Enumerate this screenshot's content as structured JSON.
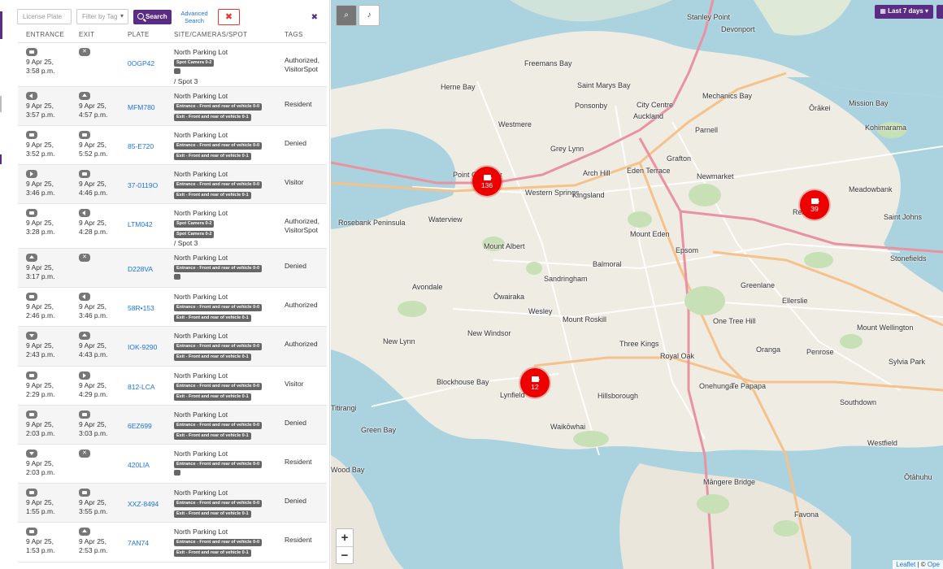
{
  "toolbar": {
    "license_placeholder": "License Plate",
    "tag_placeholder": "Filter by Tag",
    "search_label": "Search",
    "advanced_line1": "Advanced",
    "advanced_line2": "Search",
    "clear_label": "✖",
    "close_label": "✖"
  },
  "columns": [
    "ENTRANCE",
    "EXIT",
    "PLATE",
    "SITE/CAMERAS/SPOT",
    "TAGS"
  ],
  "rows": [
    {
      "entrance_icon": "cam",
      "entrance_date": "9 Apr 25,",
      "entrance_time": "3:58 p.m.",
      "exit_icon": "x",
      "exit_date": "",
      "exit_time": "",
      "plate": "0OGP42",
      "site": "North Parking Lot",
      "chips": [
        "Spot Camera 0-2",
        "_"
      ],
      "spot": "/ Spot 3",
      "tags": "Authorized, VisitorSpot"
    },
    {
      "entrance_icon": "left",
      "entrance_date": "9 Apr 25,",
      "entrance_time": "3:57 p.m.",
      "exit_icon": "up",
      "exit_date": "9 Apr 25,",
      "exit_time": "4:57 p.m.",
      "plate": "MFM780",
      "site": "North Parking Lot",
      "chips": [
        "Entrance - Front and rear of vehicle 0-0",
        "Exit - Front and rear of vehicle 0-1"
      ],
      "spot": "",
      "tags": "Resident"
    },
    {
      "entrance_icon": "cam",
      "entrance_date": "9 Apr 25,",
      "entrance_time": "3:52 p.m.",
      "exit_icon": "cam",
      "exit_date": "9 Apr 25,",
      "exit_time": "5:52 p.m.",
      "plate": "85-E720",
      "site": "North Parking Lot",
      "chips": [
        "Entrance - Front and rear of vehicle 0-0",
        "Exit - Front and rear of vehicle 0-1"
      ],
      "spot": "",
      "tags": "Denied"
    },
    {
      "entrance_icon": "right",
      "entrance_date": "9 Apr 25,",
      "entrance_time": "3:46 p.m.",
      "exit_icon": "cam",
      "exit_date": "9 Apr 25,",
      "exit_time": "4:46 p.m.",
      "plate": "37-0119O",
      "site": "North Parking Lot",
      "chips": [
        "Entrance - Front and rear of vehicle 0-0",
        "Exit - Front and rear of vehicle 0-1"
      ],
      "spot": "",
      "tags": "Visitor"
    },
    {
      "entrance_icon": "cam",
      "entrance_date": "9 Apr 25,",
      "entrance_time": "3:28 p.m.",
      "exit_icon": "left",
      "exit_date": "9 Apr 25,",
      "exit_time": "4:28 p.m.",
      "plate": "LTM042",
      "site": "North Parking Lot",
      "chips": [
        "Spot Camera 0-2",
        "Spot Camera 0-2"
      ],
      "spot": "/ Spot 3",
      "tags": "Authorized, VisitorSpot"
    },
    {
      "entrance_icon": "up",
      "entrance_date": "9 Apr 25,",
      "entrance_time": "3:17 p.m.",
      "exit_icon": "x",
      "exit_date": "",
      "exit_time": "",
      "plate": "D228VA",
      "site": "North Parking Lot",
      "chips": [
        "Entrance - Front and rear of vehicle 0-0",
        "_"
      ],
      "spot": "",
      "tags": "Denied"
    },
    {
      "entrance_icon": "cam",
      "entrance_date": "9 Apr 25,",
      "entrance_time": "2:46 p.m.",
      "exit_icon": "left",
      "exit_date": "9 Apr 25,",
      "exit_time": "3:46 p.m.",
      "plate": "58R•153",
      "site": "North Parking Lot",
      "chips": [
        "Entrance - Front and rear of vehicle 0-0",
        "Exit - Front and rear of vehicle 0-1"
      ],
      "spot": "",
      "tags": "Authorized"
    },
    {
      "entrance_icon": "down",
      "entrance_date": "9 Apr 25,",
      "entrance_time": "2:43 p.m.",
      "exit_icon": "up",
      "exit_date": "9 Apr 25,",
      "exit_time": "4:43 p.m.",
      "plate": "IOK-9290",
      "site": "North Parking Lot",
      "chips": [
        "Entrance - Front and rear of vehicle 0-0",
        "Exit - Front and rear of vehicle 0-1"
      ],
      "spot": "",
      "tags": "Authorized"
    },
    {
      "entrance_icon": "cam",
      "entrance_date": "9 Apr 25,",
      "entrance_time": "2:29 p.m.",
      "exit_icon": "right",
      "exit_date": "9 Apr 25,",
      "exit_time": "4:29 p.m.",
      "plate": "812-LCA",
      "site": "North Parking Lot",
      "chips": [
        "Entrance - Front and rear of vehicle 0-0",
        "Exit - Front and rear of vehicle 0-1"
      ],
      "spot": "",
      "tags": "Visitor"
    },
    {
      "entrance_icon": "cam",
      "entrance_date": "9 Apr 25,",
      "entrance_time": "2:03 p.m.",
      "exit_icon": "cam",
      "exit_date": "9 Apr 25,",
      "exit_time": "3:03 p.m.",
      "plate": "6EZ699",
      "site": "North Parking Lot",
      "chips": [
        "Entrance - Front and rear of vehicle 0-0",
        "Exit - Front and rear of vehicle 0-1"
      ],
      "spot": "",
      "tags": "Denied"
    },
    {
      "entrance_icon": "down",
      "entrance_date": "9 Apr 25,",
      "entrance_time": "2:03 p.m.",
      "exit_icon": "x",
      "exit_date": "",
      "exit_time": "",
      "plate": "420LIA",
      "site": "North Parking Lot",
      "chips": [
        "Entrance - Front and rear of vehicle 0-0",
        "_"
      ],
      "spot": "",
      "tags": "Resident"
    },
    {
      "entrance_icon": "cam",
      "entrance_date": "9 Apr 25,",
      "entrance_time": "1:55 p.m.",
      "exit_icon": "cam",
      "exit_date": "9 Apr 25,",
      "exit_time": "3:55 p.m.",
      "plate": "XXZ-8494",
      "site": "North Parking Lot",
      "chips": [
        "Entrance - Front and rear of vehicle 0-0",
        "Exit - Front and rear of vehicle 0-1"
      ],
      "spot": "",
      "tags": "Denied"
    },
    {
      "entrance_icon": "cam",
      "entrance_date": "9 Apr 25,",
      "entrance_time": "1:53 p.m.",
      "exit_icon": "up",
      "exit_date": "9 Apr 25,",
      "exit_time": "2:53 p.m.",
      "plate": "7AN74",
      "site": "North Parking Lot",
      "chips": [
        "Entrance - Front and rear of vehicle 0-0",
        "Exit - Front and rear of vehicle 0-1"
      ],
      "spot": "",
      "tags": "Resident"
    }
  ],
  "map": {
    "date_range": "Last 7 days",
    "date_icon": "calendar-icon",
    "zoom_in": "+",
    "zoom_out": "−",
    "attribution_lib": "Leaflet",
    "attribution_sep": " | © ",
    "attribution_src": "Ope",
    "clusters": [
      {
        "count": "136"
      },
      {
        "count": "39"
      },
      {
        "count": "12"
      }
    ],
    "labels": [
      "Auckland",
      "Ponsonby",
      "Grey Lynn",
      "Parnell",
      "Grafton",
      "Newmarket",
      "Remuera",
      "Epsom",
      "Mount Eden",
      "Mount Albert",
      "Sandringham",
      "Balmoral",
      "Waterview",
      "Avondale",
      "New Windsor",
      "Mount Roskill",
      "Three Kings",
      "Royal Oak",
      "Onehunga",
      "Hillsborough",
      "Lynfield",
      "Blockhouse Bay",
      "Waikōwhai",
      "One Tree Hill",
      "Ellerslie",
      "Greenlane",
      "Penrose",
      "Mount Wellington",
      "Meadowbank",
      "Saint Johns",
      "Stonefields",
      "Ōrākei",
      "Mission Bay",
      "Kohimarama",
      "Devonport",
      "Stanley Point",
      "Westmere",
      "Point Chevalier",
      "Western Springs",
      "Kingsland",
      "Arch Hill",
      "Eden Terrace",
      "City Centre",
      "Freemans Bay",
      "Saint Marys Bay",
      "Herne Bay",
      "Rosebank Peninsula",
      "Māngere Bridge",
      "Te Papapa",
      "Oranga",
      "Sylvia Park",
      "Ōwairaka",
      "Wesley",
      "New Lynn",
      "Titirangi",
      "Green Bay",
      "Wood Bay",
      "Favona",
      "Ōtāhuhu",
      "Westfield",
      "Southdown",
      "Mechanics Bay"
    ]
  }
}
